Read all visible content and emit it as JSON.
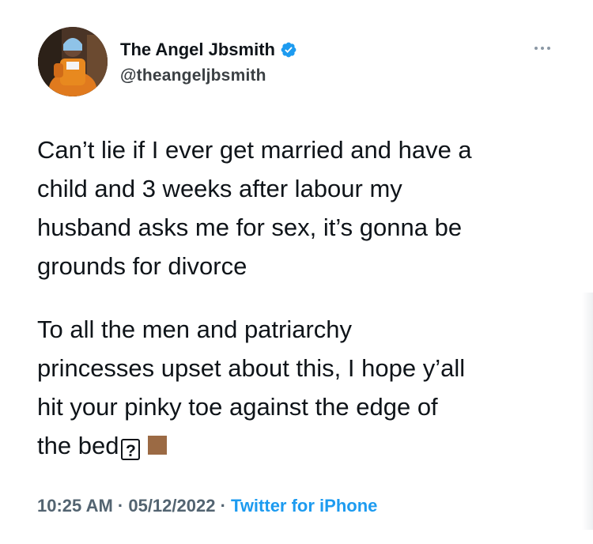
{
  "author": {
    "display_name": "The Angel Jbsmith",
    "handle": "@theangeljbsmith",
    "verified_icon": "verified-badge-icon",
    "badge_color": "#1d9bf0"
  },
  "tweet": {
    "paragraph_1": "Can’t lie if I ever get married and have a\nchild and 3 weeks after labour my\nhusband asks me for sex, it’s gonna be\ngrounds for divorce",
    "paragraph_2_main": "To all the men and patriarchy\nprincesses upset about this, I hope y’all\nhit your pinky toe against the edge of\nthe bed",
    "missing_glyph": "?",
    "brown_square_color": "#9b6a44"
  },
  "meta": {
    "time": "10:25 AM",
    "separator": " · ",
    "date": "05/12/2022",
    "source": "Twitter for iPhone"
  },
  "colors": {
    "text": "#0f1419",
    "secondary": "#536471",
    "link": "#1d9bf0"
  }
}
